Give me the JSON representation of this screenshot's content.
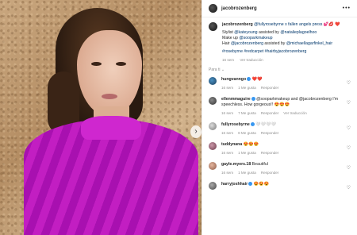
{
  "post": {
    "username": "jacobrozenberg",
    "more_label": "•••",
    "carousel_arrow": "›"
  },
  "caption": {
    "username": "jacobrozenberg",
    "text_1": "@fullyrosebyrne x fallen angels press 💕💋",
    "text_2": "❤️",
    "stylist_prefix": "Stylist ",
    "stylist": "@kateyoung",
    "assisted_1": " assisted by ",
    "stylist_assist": "@natalieplagoelhoo",
    "makeup_prefix": "Make up ",
    "makeup": "@sooparkmakeup",
    "hair_prefix": "Hair ",
    "hair": "@jacobrozenberg",
    "assisted_2": " assisted by ",
    "hair_assist": "@michaellagarfinkel_hair",
    "hashtags": "#rosebyrne #redcarpet #hairbyjacobrozenberg",
    "time": "16 sem",
    "translate": "Ver traducción"
  },
  "sort_label": "Para ti ⌄",
  "comments": [
    {
      "user": "hungvanngo",
      "verified": true,
      "text": "❤️❤️",
      "time": "16 sem",
      "likes": "1 Me gusta",
      "reply": "Responder"
    },
    {
      "user": "ellenmmaguire",
      "verified": true,
      "text": "@sooparkmakeup and @jacobrozenberg I'm speechless. How gorgeous!! 😍😍😍",
      "time": "16 sem",
      "likes": "7 Me gusta",
      "reply": "Responder",
      "translate": "Ver traducción"
    },
    {
      "user": "fullyrosebyrne",
      "verified": true,
      "text": "🤍🤍🤍🤍",
      "time": "16 sem",
      "likes": "8 Me gusta",
      "reply": "Responder"
    },
    {
      "user": "tuddynana",
      "verified": false,
      "text": "😍😍😍",
      "time": "16 sem",
      "likes": "1 Me gusta",
      "reply": "Responder"
    },
    {
      "user": "gayle.myers.18",
      "verified": false,
      "text": "Beautiful",
      "time": "16 sem",
      "likes": "1 Me gusta",
      "reply": "Responder"
    },
    {
      "user": "harryjoshhair",
      "verified": true,
      "text": "😍😍😍",
      "time": "",
      "likes": "",
      "reply": ""
    }
  ],
  "icons": {
    "heart": "♡"
  }
}
